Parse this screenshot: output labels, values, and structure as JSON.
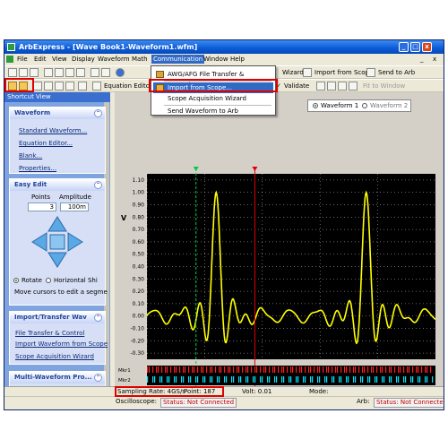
{
  "window": {
    "title": "ArbExpress - [Wave Book1-Waveform1.wfm]",
    "controls": [
      "_",
      "□",
      "x"
    ],
    "mdi_controls": [
      "_",
      "x"
    ]
  },
  "menu": {
    "items": [
      "File",
      "Edit",
      "View",
      "Display",
      "Waveform",
      "Math",
      "Communication",
      "Window",
      "Help"
    ],
    "active": "Communication"
  },
  "dropdown": {
    "items": [
      "AWG/AFG File Transfer & Control...",
      "Import from Scope...",
      "Scope Acquisition Wizard",
      "Send Waveform to Arb"
    ],
    "highlighted_index": 1
  },
  "toolbar1": {
    "wizard_label": "Wizard",
    "import_label": "Import from Scope",
    "send_label": "Send to Arb"
  },
  "toolbar2": {
    "equation_label": "Equation Editor",
    "validate_label": "Validate",
    "fit_label": "Fit to Window"
  },
  "waveform_tabs": {
    "options": [
      "Waveform 1",
      "Waveform 2"
    ],
    "selected": "Waveform 1"
  },
  "sidebar": {
    "title": "Shortcut View",
    "waveform_panel": {
      "title": "Waveform",
      "links": [
        "Standard Waveform...",
        "Equation Editor...",
        "Blank...",
        "Properties..."
      ]
    },
    "easy_edit_panel": {
      "title": "Easy Edit",
      "points_label": "Points",
      "amplitude_label": "Amplitude",
      "points_value": "3",
      "amplitude_value": "100m",
      "mode_options": [
        "Rotate",
        "Horizontal Shi"
      ],
      "mode_selected": "Rotate",
      "hint": "Move cursors to edit a segme"
    },
    "import_panel": {
      "title": "Import/Transfer Wav",
      "links": [
        "File Transfer & Control",
        "Import  Waveform from Scope",
        "Scope Acquisition Wizard"
      ]
    },
    "multi_panel": {
      "title": "Multi-Waveform Pro..."
    }
  },
  "plot": {
    "ylabel": "V",
    "xlabel": "Points",
    "y_ticks": [
      "1.10",
      "1.00",
      "0.90",
      "0.80",
      "0.70",
      "0.60",
      "0.50",
      "0.40",
      "0.30",
      "0.20",
      "0.10",
      "0.00",
      "-0.10",
      "-0.20",
      "-0.30"
    ],
    "x_ticks": [
      "0",
      "100",
      "200",
      "300",
      "400"
    ],
    "marker_labels": [
      "Mkr1",
      "Mkr2"
    ],
    "colors": {
      "background": "#000000",
      "trace": "#ffff00",
      "grid": "#ffffff",
      "cursor1": "#00cc44",
      "cursor2": "#e00000",
      "marker1": "#ff2020",
      "marker2": "#00e5ff"
    }
  },
  "chart_data": {
    "type": "line",
    "title": "",
    "xlabel": "Points",
    "ylabel": "V",
    "xlim": [
      0,
      500
    ],
    "ylim": [
      -0.35,
      1.15
    ],
    "grid": true,
    "series": [
      {
        "peaks_at": [
          120,
          380
        ],
        "peak_value": 1.0,
        "baseline": 0.0,
        "ripple_amplitude": 0.05,
        "peak_width_points": 28
      }
    ],
    "cursors": [
      {
        "x": 85
      },
      {
        "x": 187
      }
    ]
  },
  "status": {
    "sampling": "Sampling Rate: 4GS/s",
    "point": "Point: 187",
    "volt": "Volt: 0.01",
    "mode": "Mode:",
    "osc_label": "Oscilloscope:",
    "osc_status": "Status: Not Connected",
    "arb_label": "Arb:",
    "arb_status": "Status: Not Connected"
  }
}
